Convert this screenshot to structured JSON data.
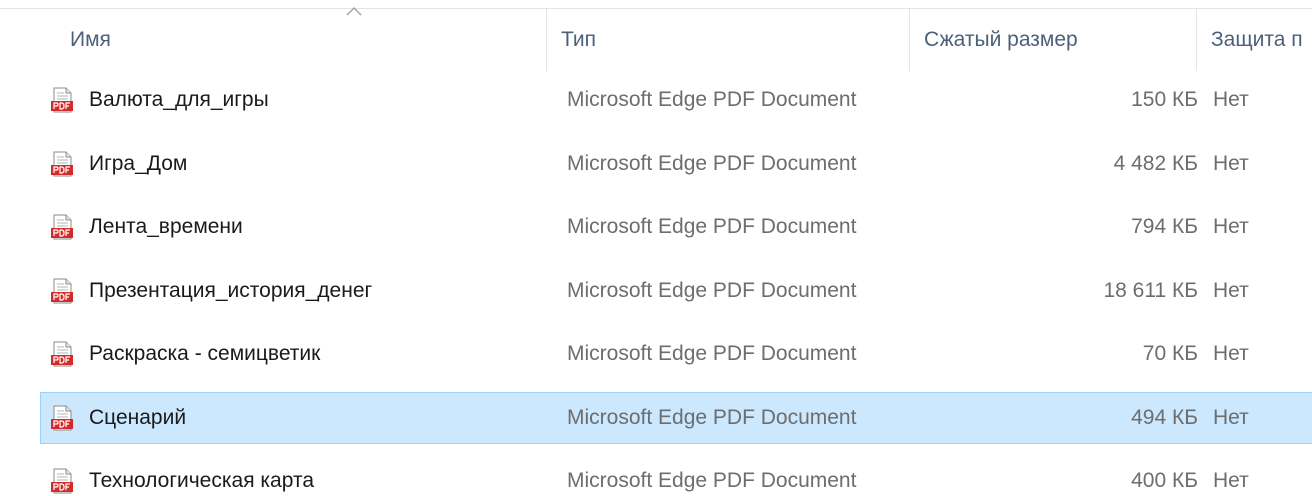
{
  "columns": {
    "name": "Имя",
    "type": "Тип",
    "size": "Сжатый размер",
    "protection": "Защита п"
  },
  "sort": {
    "column": "name",
    "direction": "ascending",
    "icon": "chevron-up-icon"
  },
  "colors": {
    "selection_bg": "#cce8ff",
    "selection_border": "#99d1ff",
    "header_text": "#4c607a",
    "pdf_red": "#d22b2b"
  },
  "files": [
    {
      "name": "Валюта_для_игры",
      "type": "Microsoft Edge PDF Document",
      "size": "150 КБ",
      "protection": "Нет",
      "icon": "pdf-file-icon",
      "selected": false
    },
    {
      "name": "Игра_Дом",
      "type": "Microsoft Edge PDF Document",
      "size": "4 482 КБ",
      "protection": "Нет",
      "icon": "pdf-file-icon",
      "selected": false
    },
    {
      "name": "Лента_времени",
      "type": "Microsoft Edge PDF Document",
      "size": "794 КБ",
      "protection": "Нет",
      "icon": "pdf-file-icon",
      "selected": false
    },
    {
      "name": "Презентация_история_денег",
      "type": "Microsoft Edge PDF Document",
      "size": "18 611 КБ",
      "protection": "Нет",
      "icon": "pdf-file-icon",
      "selected": false
    },
    {
      "name": "Раскраска - семицветик",
      "type": "Microsoft Edge PDF Document",
      "size": "70 КБ",
      "protection": "Нет",
      "icon": "pdf-file-icon",
      "selected": false
    },
    {
      "name": "Сценарий",
      "type": "Microsoft Edge PDF Document",
      "size": "494 КБ",
      "protection": "Нет",
      "icon": "pdf-file-icon",
      "selected": true
    },
    {
      "name": "Технологическая карта",
      "type": "Microsoft Edge PDF Document",
      "size": "400 КБ",
      "protection": "Нет",
      "icon": "pdf-file-icon",
      "selected": false
    }
  ]
}
